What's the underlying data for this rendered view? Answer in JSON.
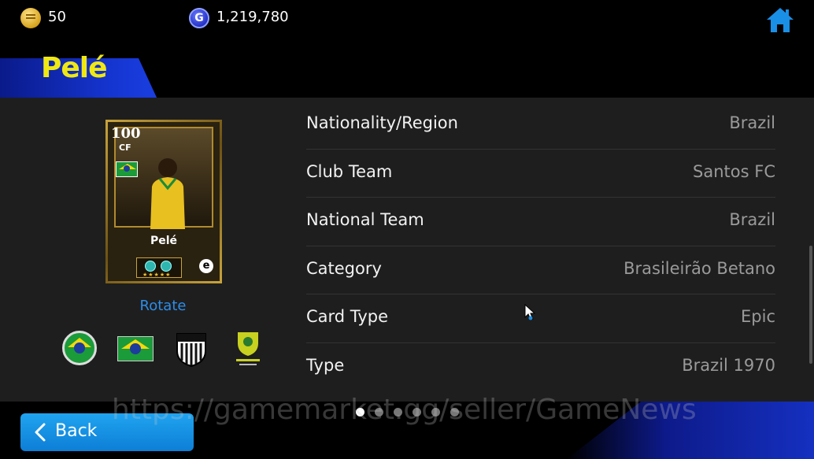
{
  "currency": {
    "coins_value": "50",
    "gp_value": "1,219,780",
    "gp_symbol": "G"
  },
  "player": {
    "name": "Pelé",
    "card": {
      "rating": "100",
      "position": "CF",
      "name": "Pelé",
      "stars": "★★★★★",
      "logo_letter": "e"
    }
  },
  "rotate_label": "Rotate",
  "details": [
    {
      "label": "Nationality/Region",
      "value": "Brazil"
    },
    {
      "label": "Club Team",
      "value": "Santos FC"
    },
    {
      "label": "National Team",
      "value": "Brazil"
    },
    {
      "label": "Category",
      "value": "Brasileirão Betano"
    },
    {
      "label": "Card Type",
      "value": "Epic"
    },
    {
      "label": "Type",
      "value": "Brazil 1970"
    }
  ],
  "pagination": {
    "total": 6,
    "active": 1
  },
  "back_label": "Back",
  "watermark": "https://gamemarket.gg/seller/GameNews",
  "colors": {
    "title": "#f0e814",
    "accent_blue": "#1a8fe6",
    "link": "#2d8de8"
  }
}
